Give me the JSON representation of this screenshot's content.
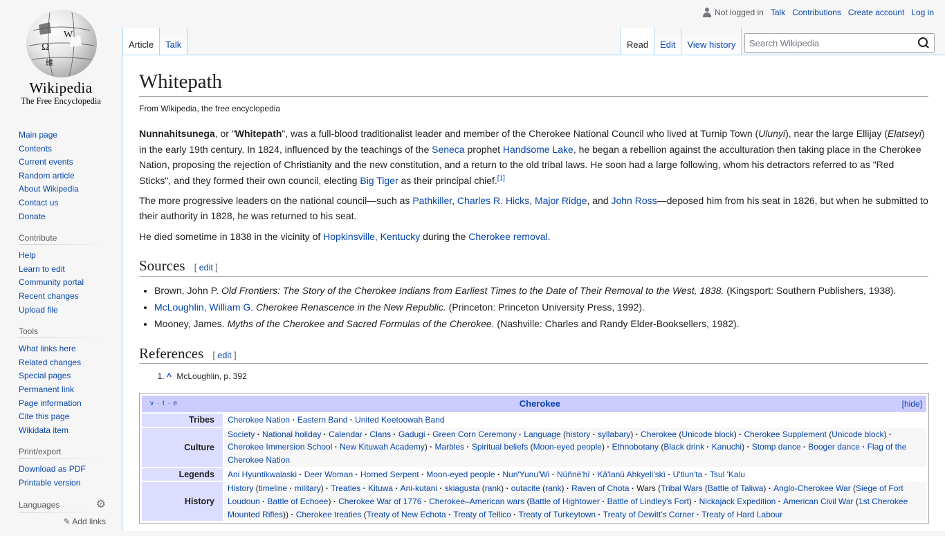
{
  "logo": {
    "wordmark": "Wikipedia",
    "tagline": "The Free Encyclopedia",
    "glyphs": [
      "Ω",
      "W",
      "維"
    ]
  },
  "sidebar": {
    "navigation": [
      "Main page",
      "Contents",
      "Current events",
      "Random article",
      "About Wikipedia",
      "Contact us",
      "Donate"
    ],
    "contribute": {
      "heading": "Contribute",
      "items": [
        "Help",
        "Learn to edit",
        "Community portal",
        "Recent changes",
        "Upload file"
      ]
    },
    "tools": {
      "heading": "Tools",
      "items": [
        "What links here",
        "Related changes",
        "Special pages",
        "Permanent link",
        "Page information",
        "Cite this page",
        "Wikidata item"
      ]
    },
    "print": {
      "heading": "Print/export",
      "items": [
        "Download as PDF",
        "Printable version"
      ]
    },
    "languages": {
      "heading": "Languages",
      "add_links": "Add links",
      "icon": "gear-icon"
    }
  },
  "personal": {
    "not_logged_in": "Not logged in",
    "talk": "Talk",
    "contributions": "Contributions",
    "create_account": "Create account",
    "login": "Log in",
    "icon": "user-icon"
  },
  "tabs": {
    "left": [
      "Article",
      "Talk"
    ],
    "right": [
      "Read",
      "Edit",
      "View history"
    ]
  },
  "search": {
    "placeholder": "Search Wikipedia",
    "icon": "search-icon"
  },
  "article": {
    "title": "Whitepath",
    "tagline": "From Wikipedia, the free encyclopedia",
    "p1": [
      {
        "t": "Nunnahitsunega",
        "s": "b"
      },
      {
        "t": ", or \""
      },
      {
        "t": "Whitepath",
        "s": "b"
      },
      {
        "t": "\", was a full-blood traditionalist leader and member of the Cherokee National Council who lived at Turnip Town ("
      },
      {
        "t": "Ulunyi",
        "s": "i"
      },
      {
        "t": "), near the large Ellijay ("
      },
      {
        "t": "Elatseyi",
        "s": "i"
      },
      {
        "t": ") in the early 19th century. In 1824, influenced by the teachings of the "
      },
      {
        "t": "Seneca",
        "s": "a"
      },
      {
        "t": " prophet "
      },
      {
        "t": "Handsome Lake",
        "s": "a"
      },
      {
        "t": ", he began a rebellion against the acculturation then taking place in the Cherokee Nation, proposing the rejection of Christianity and the new constitution, and a return to the old tribal laws. He soon had a large following, whom his detractors referred to as \"Red Sticks\", and they formed their own council, electing "
      },
      {
        "t": "Big Tiger",
        "s": "a"
      },
      {
        "t": " as their principal chief."
      },
      {
        "t": "[1]",
        "s": "sup"
      }
    ],
    "p2": [
      {
        "t": "The more progressive leaders on the national council—such as "
      },
      {
        "t": "Pathkiller",
        "s": "a"
      },
      {
        "t": ", "
      },
      {
        "t": "Charles R. Hicks",
        "s": "a"
      },
      {
        "t": ", "
      },
      {
        "t": "Major Ridge",
        "s": "a"
      },
      {
        "t": ", and "
      },
      {
        "t": "John Ross",
        "s": "a"
      },
      {
        "t": "—deposed him from his seat in 1826, but when he submitted to their authority in 1828, he was returned to his seat."
      }
    ],
    "p3": [
      {
        "t": "He died sometime in 1838 in the vicinity of "
      },
      {
        "t": "Hopkinsville, Kentucky",
        "s": "a"
      },
      {
        "t": " during the "
      },
      {
        "t": "Cherokee removal",
        "s": "a"
      },
      {
        "t": "."
      }
    ],
    "sources_heading": "Sources",
    "references_heading": "References",
    "edit_label": "edit",
    "sources": [
      [
        {
          "t": "Brown, John P. "
        },
        {
          "t": "Old Frontiers: The Story of the Cherokee Indians from Earliest Times to the Date of Their Removal to the West, 1838.",
          "s": "i"
        },
        {
          "t": " (Kingsport: Southern Publishers, 1938)."
        }
      ],
      [
        {
          "t": "McLoughlin, William G.",
          "s": "a"
        },
        {
          "t": " "
        },
        {
          "t": "Cherokee Renascence in the New Republic.",
          "s": "i"
        },
        {
          "t": " (Princeton: Princeton University Press, 1992)."
        }
      ],
      [
        {
          "t": "Mooney, James. "
        },
        {
          "t": "Myths of the Cherokee and Sacred Formulas of the Cherokee.",
          "s": "i"
        },
        {
          "t": " (Nashville: Charles and Randy Elder-Booksellers, 1982)."
        }
      ]
    ],
    "references": [
      {
        "caret": "^",
        "text": "McLoughlin, p. 392"
      }
    ]
  },
  "navbox": {
    "vte": "v · t · e",
    "title": "Cherokee",
    "hide": "[hide]",
    "rows": [
      {
        "group": "Tribes",
        "items": [
          [
            {
              "t": "Cherokee Nation",
              "s": "a"
            }
          ],
          [
            {
              "t": "Eastern Band",
              "s": "a"
            }
          ],
          [
            {
              "t": "United Keetoowah Band",
              "s": "a"
            }
          ]
        ]
      },
      {
        "group": "Culture",
        "items": [
          [
            {
              "t": "Society",
              "s": "a"
            }
          ],
          [
            {
              "t": "National holiday",
              "s": "a"
            }
          ],
          [
            {
              "t": "Calendar",
              "s": "a"
            }
          ],
          [
            {
              "t": "Clans",
              "s": "a"
            }
          ],
          [
            {
              "t": "Gadugi",
              "s": "a"
            }
          ],
          [
            {
              "t": "Green Corn Ceremony",
              "s": "a"
            }
          ],
          [
            {
              "t": "Language",
              "s": "a"
            },
            {
              "t": " ("
            },
            {
              "t": "history",
              "s": "a"
            },
            {
              "t": " · ",
              "s": "dot"
            },
            {
              "t": "syllabary",
              "s": "a"
            },
            {
              "t": ")"
            }
          ],
          [
            {
              "t": "Cherokee",
              "s": "a"
            },
            {
              "t": " ("
            },
            {
              "t": "Unicode block",
              "s": "a"
            },
            {
              "t": ")"
            }
          ],
          [
            {
              "t": "Cherokee Supplement",
              "s": "a"
            },
            {
              "t": " ("
            },
            {
              "t": "Unicode block",
              "s": "a"
            },
            {
              "t": ")"
            }
          ],
          [
            {
              "t": "Cherokee Immersion School",
              "s": "a"
            }
          ],
          [
            {
              "t": "New Kituwah Academy",
              "s": "a"
            },
            {
              "t": ")"
            }
          ],
          [
            {
              "t": "Marbles",
              "s": "a"
            }
          ],
          [
            {
              "t": "Spiritual beliefs",
              "s": "a"
            },
            {
              "t": " ("
            },
            {
              "t": "Moon-eyed people",
              "s": "a"
            },
            {
              "t": ")"
            }
          ],
          [
            {
              "t": "Ethnobotany",
              "s": "a"
            },
            {
              "t": " ("
            },
            {
              "t": "Black drink",
              "s": "a"
            },
            {
              "t": " · ",
              "s": "dot"
            },
            {
              "t": "Kanuchi",
              "s": "a"
            },
            {
              "t": ")"
            }
          ],
          [
            {
              "t": "Stomp dance",
              "s": "a"
            }
          ],
          [
            {
              "t": "Booger dance",
              "s": "a"
            }
          ],
          [
            {
              "t": "Flag of the Cherokee Nation",
              "s": "a"
            }
          ]
        ]
      },
      {
        "group": "Legends",
        "items": [
          [
            {
              "t": "Ani Hyuntikwalaski",
              "s": "a"
            }
          ],
          [
            {
              "t": "Deer Woman",
              "s": "a"
            }
          ],
          [
            {
              "t": "Horned Serpent",
              "s": "a"
            }
          ],
          [
            {
              "t": "Moon-eyed people",
              "s": "a"
            }
          ],
          [
            {
              "t": "Nun'Yunu'Wi",
              "s": "a"
            }
          ],
          [
            {
              "t": "Nûñnë'hï",
              "s": "a"
            }
          ],
          [
            {
              "t": "Kâ'lanû Ahkyeli'skï",
              "s": "a"
            }
          ],
          [
            {
              "t": "U'tlun'ta",
              "s": "a"
            }
          ],
          [
            {
              "t": "Tsul 'Kalu",
              "s": "a"
            }
          ]
        ]
      },
      {
        "group": "History",
        "items": [
          [
            {
              "t": "History",
              "s": "a"
            },
            {
              "t": " ("
            },
            {
              "t": "timeline",
              "s": "a"
            },
            {
              "t": " · ",
              "s": "dot"
            },
            {
              "t": "military",
              "s": "a"
            },
            {
              "t": ")"
            }
          ],
          [
            {
              "t": "Treaties",
              "s": "a"
            }
          ],
          [
            {
              "t": "Kituwa",
              "s": "a"
            }
          ],
          [
            {
              "t": "Ani-kutani",
              "s": "a"
            }
          ],
          [
            {
              "t": "skiagusta",
              "s": "a"
            },
            {
              "t": " ("
            },
            {
              "t": "rank",
              "s": "a"
            },
            {
              "t": ")"
            }
          ],
          [
            {
              "t": "outacite",
              "s": "a"
            },
            {
              "t": " ("
            },
            {
              "t": "rank",
              "s": "a"
            },
            {
              "t": ")"
            }
          ],
          [
            {
              "t": "Raven of Chota",
              "s": "a"
            }
          ],
          [
            {
              "t": "Wars ("
            },
            {
              "t": "Tribal Wars",
              "s": "a"
            },
            {
              "t": " ("
            },
            {
              "t": "Battle of Taliwa",
              "s": "a"
            },
            {
              "t": ")"
            }
          ],
          [
            {
              "t": "Anglo-Cherokee War",
              "s": "a"
            },
            {
              "t": " ("
            },
            {
              "t": "Siege of Fort Loudoun",
              "s": "a"
            }
          ],
          [
            {
              "t": "Battle of Echoee",
              "s": "a"
            },
            {
              "t": ")"
            }
          ],
          [
            {
              "t": "Cherokee War of 1776",
              "s": "a"
            }
          ],
          [
            {
              "t": "Cherokee–American wars",
              "s": "a"
            },
            {
              "t": " ("
            },
            {
              "t": "Battle of Hightower",
              "s": "a"
            }
          ],
          [
            {
              "t": "Battle of Lindley's Fort",
              "s": "a"
            },
            {
              "t": ")"
            }
          ],
          [
            {
              "t": "Nickajack Expedition",
              "s": "a"
            }
          ],
          [
            {
              "t": "American Civil War",
              "s": "a"
            },
            {
              "t": " ("
            },
            {
              "t": "1st Cherokee Mounted Rifles",
              "s": "a"
            },
            {
              "t": "))"
            }
          ],
          [
            {
              "t": "Cherokee treaties",
              "s": "a"
            },
            {
              "t": " ("
            },
            {
              "t": "Treaty of New Echota",
              "s": "a"
            }
          ],
          [
            {
              "t": "Treaty of Tellico",
              "s": "a"
            }
          ],
          [
            {
              "t": "Treaty of Turkeytown",
              "s": "a"
            }
          ],
          [
            {
              "t": "Treaty of Dewitt's Corner",
              "s": "a"
            }
          ],
          [
            {
              "t": "Treaty of Hard Labour",
              "s": "a"
            }
          ]
        ]
      }
    ]
  }
}
